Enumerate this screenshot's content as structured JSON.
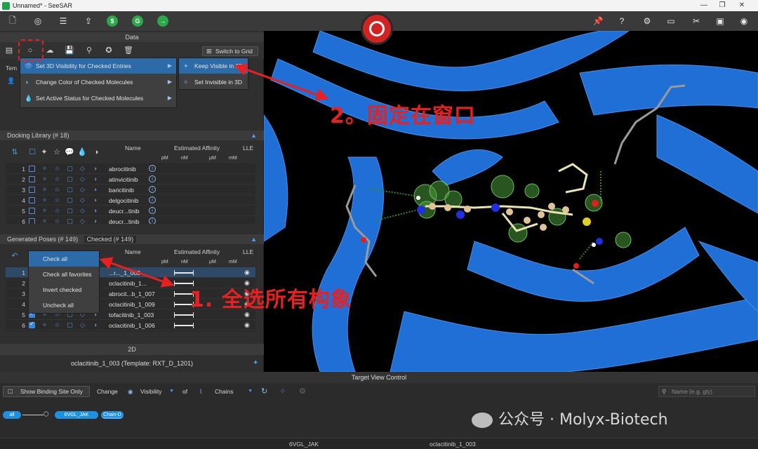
{
  "window": {
    "title": "Unnamed* - SeeSAR",
    "minimize": "—",
    "restore": "❐",
    "close": "✕"
  },
  "toolbar": {
    "green_buttons": [
      "$",
      "G",
      "→"
    ],
    "right_icons": [
      "pin-icon",
      "help-icon",
      "gear-icon",
      "monitor-icon",
      "tools-icon",
      "window-icon",
      "eye-icon"
    ]
  },
  "data_panel": {
    "title": "Data",
    "switch_grid_label": "Switch to Grid",
    "template_tab": "Tem",
    "context_menu": [
      {
        "label": "Set 3D Visibility for Checked Entries",
        "highlighted": true
      },
      {
        "label": "Change Color of Checked Molecules",
        "highlighted": false
      },
      {
        "label": "Set Active Status for Checked Molecules",
        "highlighted": false
      }
    ],
    "submenu": [
      {
        "label": "Keep Visible in 3D",
        "highlighted": true
      },
      {
        "label": "Set Invisible in 3D",
        "highlighted": false
      }
    ]
  },
  "docking_library": {
    "title": "Docking Library (# 18)",
    "columns": {
      "name": "Name",
      "affinity": "Estimated Affinity",
      "lle": "LLE",
      "units": [
        "pM",
        "nM",
        "μM",
        "mM"
      ]
    },
    "rows": [
      {
        "num": "1",
        "name": "abrocitinib"
      },
      {
        "num": "2",
        "name": "atinvicitinib"
      },
      {
        "num": "3",
        "name": "baricitinib"
      },
      {
        "num": "4",
        "name": "delgocitinib"
      },
      {
        "num": "5",
        "name": "deucr...tinib"
      },
      {
        "num": "6",
        "name": "deucr...tinib"
      }
    ]
  },
  "generated_poses": {
    "title": "Generated Poses (# 149)",
    "checked_tab": "Checked (# 149)",
    "columns": {
      "name": "Name",
      "affinity": "Estimated Affinity",
      "lle": "LLE",
      "units": [
        "pM",
        "nM",
        "μM",
        "mM"
      ]
    },
    "check_menu": [
      "Check all",
      "Check all favorites",
      "Invert checked",
      "Uncheck all"
    ],
    "rows": [
      {
        "num": "1",
        "name": "...r..._1_003",
        "checked": true
      },
      {
        "num": "2",
        "name": "oclacitinib_1...",
        "checked": true
      },
      {
        "num": "3",
        "name": "abrocit...b_1_007",
        "checked": true
      },
      {
        "num": "4",
        "name": "oclacitinib_1_009",
        "checked": true
      },
      {
        "num": "5",
        "name": "tofacitinib_1_003",
        "checked": true
      },
      {
        "num": "6",
        "name": "oclacitinib_1_006",
        "checked": true
      }
    ]
  },
  "panel_2d": {
    "title": "2D",
    "caption": "oclacitinib_1_003 (Template: RXT_D_1201)"
  },
  "annotations": {
    "step1": "1. 全选所有构象",
    "step2": "2。固定在窗口"
  },
  "target_view": {
    "title": "Target View Control",
    "show_binding_site": "Show Binding Site Only",
    "change": "Change",
    "visibility": "Visibility",
    "of": "of",
    "chains": "Chains",
    "search_placeholder": "Name (e.g. gly)",
    "tree": {
      "all": "all",
      "protein": "6VGL_JAK",
      "chain": "Chain-D"
    }
  },
  "status": {
    "left": "6VGL_JAK",
    "right": "oclacitinib_1_003"
  },
  "watermark": "公众号 · Molyx-Biotech",
  "colors": {
    "accent": "#2d6aa8",
    "annotation": "#e82020",
    "logo": "#d32222",
    "ribbon": "#1f6fd6"
  }
}
